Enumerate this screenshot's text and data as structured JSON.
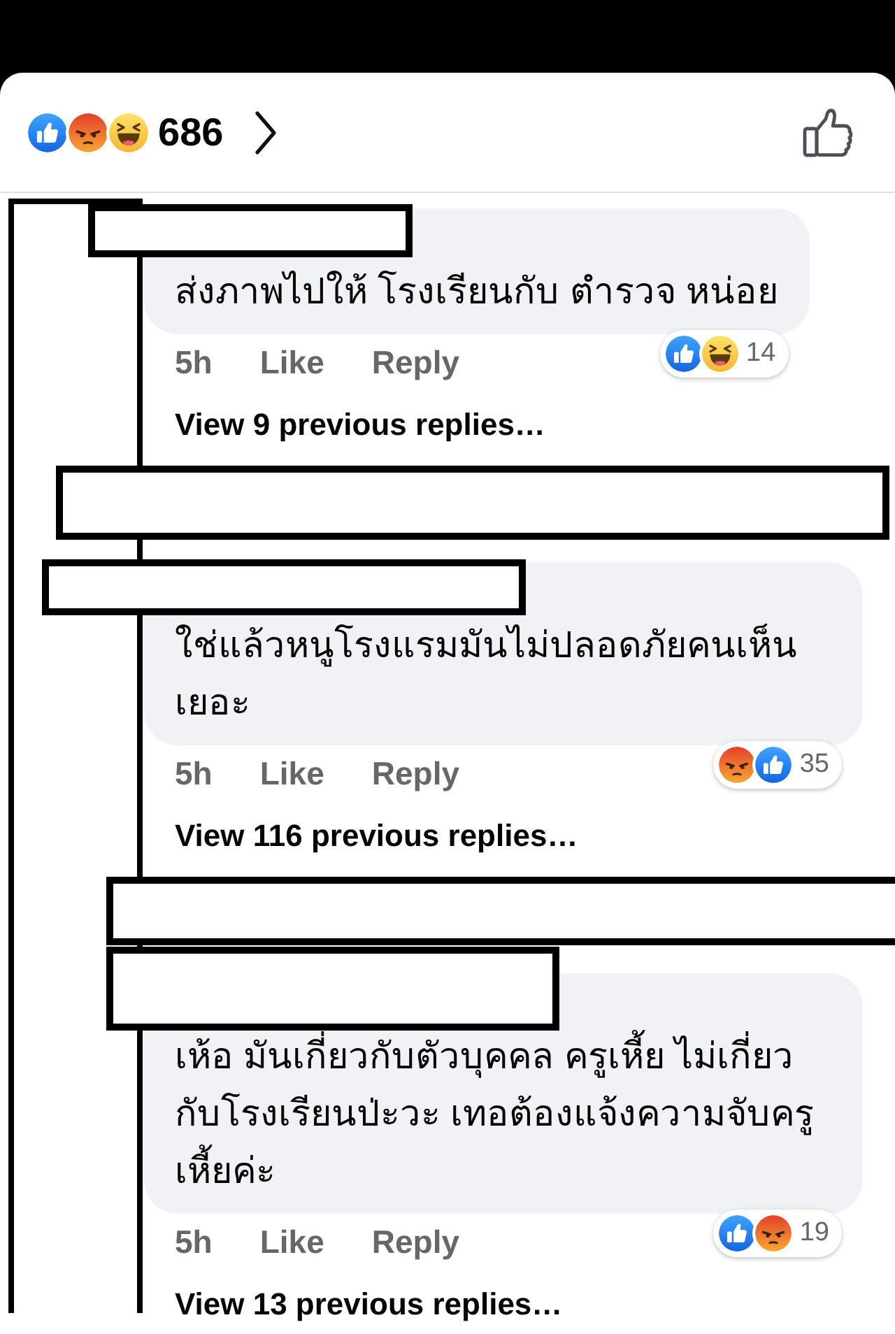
{
  "header": {
    "reactions": [
      {
        "kind": "like"
      },
      {
        "kind": "angry"
      },
      {
        "kind": "haha"
      }
    ],
    "count": "686"
  },
  "thread": [
    {
      "kind": "comment",
      "author_redacted": true,
      "text": "ส่งภาพไปให้ โรงเรียนกับ ตำรวจ หน่อย",
      "time": "5h",
      "actions": [
        "Like",
        "Reply"
      ],
      "reactions": [
        {
          "kind": "like"
        },
        {
          "kind": "haha"
        }
      ],
      "reaction_count": "14",
      "more_replies": "View 9 previous replies…"
    },
    {
      "kind": "redacted"
    },
    {
      "kind": "comment",
      "author_redacted": true,
      "text": "ใช่แล้วหนูโรงแรมมันไม่ปลอดภัยคนเห็นเยอะ",
      "time": "5h",
      "actions": [
        "Like",
        "Reply"
      ],
      "reactions": [
        {
          "kind": "angry"
        },
        {
          "kind": "like"
        }
      ],
      "reaction_count": "35",
      "more_replies": "View 116 previous replies…"
    },
    {
      "kind": "redacted"
    },
    {
      "kind": "comment",
      "author_redacted": true,
      "text": "เห้อ มันเกี่ยวกับตัวบุคคล ครูเหี้ย ไม่เกี่ยวกับโรงเรียนป่ะวะ เทอต้องแจ้งความจับครูเหี้ยค่ะ",
      "time": "5h",
      "actions": [
        "Like",
        "Reply"
      ],
      "reactions": [
        {
          "kind": "like"
        },
        {
          "kind": "angry"
        }
      ],
      "reaction_count": "19",
      "more_replies": "View 13 previous replies…"
    }
  ]
}
